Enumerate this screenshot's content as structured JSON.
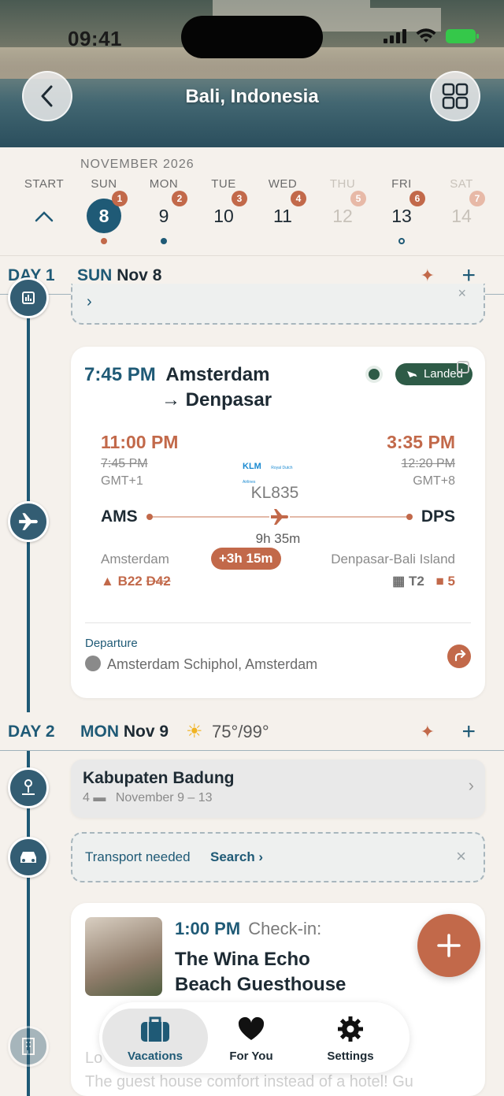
{
  "status": {
    "time": "09:41"
  },
  "header": {
    "title": "Bali, Indonesia"
  },
  "calendar": {
    "month": "NOVEMBER 2026",
    "start_label": "START",
    "days": [
      {
        "dow": "SUN",
        "num": "8",
        "badge": "1",
        "dot": "red",
        "selected": true
      },
      {
        "dow": "MON",
        "num": "9",
        "badge": "2",
        "dot": "blue"
      },
      {
        "dow": "TUE",
        "num": "10",
        "badge": "3"
      },
      {
        "dow": "WED",
        "num": "11",
        "badge": "4"
      },
      {
        "dow": "THU",
        "num": "12",
        "badge": "5",
        "faded": true
      },
      {
        "dow": "FRI",
        "num": "13",
        "badge": "6",
        "dot": "ring"
      },
      {
        "dow": "SAT",
        "num": "14",
        "badge": "7",
        "faded": true
      }
    ]
  },
  "day1": {
    "label": "DAY 1",
    "dow": "SUN",
    "date": "Nov 8"
  },
  "flight": {
    "time": "7:45 PM",
    "route_from": "Amsterdam",
    "route_to": "→ Denpasar",
    "status": "Landed",
    "dep_time": "11:00 PM",
    "dep_sched": "7:45 PM",
    "dep_tz": "GMT+1",
    "arr_time": "3:35 PM",
    "arr_sched": "12:20 PM",
    "arr_tz": "GMT+8",
    "airline_logo": "KLM",
    "airline_sub": "Royal Dutch Airlines",
    "flight_no": "KL835",
    "from_code": "AMS",
    "to_code": "DPS",
    "duration": "9h 35m",
    "from_city": "Amsterdam",
    "delay": "+3h 15m",
    "to_city": "Denpasar-Bali Island",
    "gate_new": "B22",
    "gate_old": "D42",
    "terminal": "T2",
    "baggage": "5",
    "departure_label": "Departure",
    "departure_place": "Amsterdam Schiphol, Amsterdam"
  },
  "day2": {
    "label": "DAY 2",
    "dow": "MON",
    "date": "Nov 9",
    "weather": "75°/99°"
  },
  "stay": {
    "title": "Kabupaten Badung",
    "nights": "4",
    "dates": "November 9 – 13"
  },
  "transport": {
    "needed": "Transport needed",
    "search": "Search"
  },
  "hotel": {
    "time": "1:00 PM",
    "event": "Check-in:",
    "name_line1": "The Wina Echo",
    "name_line2": "Beach Guesthouse",
    "faded_prefix": "Lo",
    "faded_text": "The guest house comfort instead of a hotel! Gu"
  },
  "tabs": {
    "vacations": "Vacations",
    "for_you": "For You",
    "settings": "Settings"
  },
  "colors": {
    "primary": "#1f5a76",
    "accent": "#c2694a",
    "landed": "#2e5b47"
  }
}
